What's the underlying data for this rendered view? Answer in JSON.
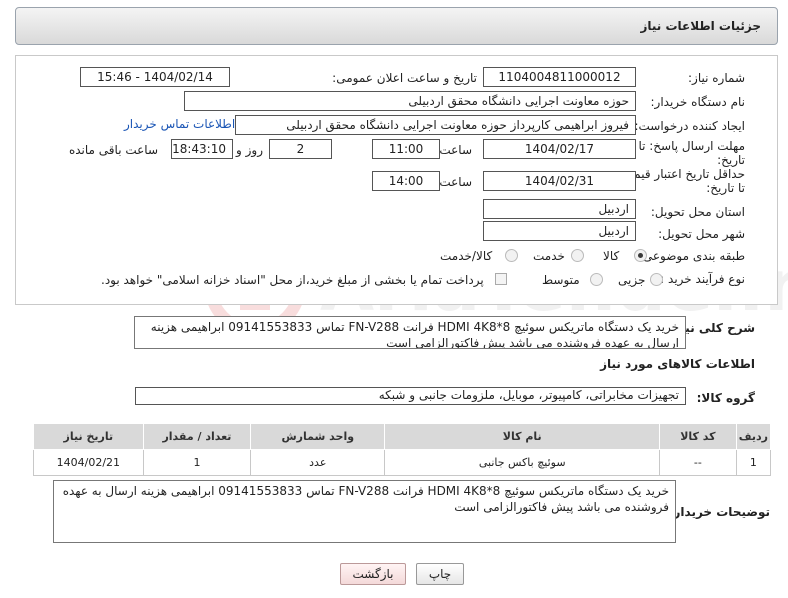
{
  "header": {
    "title": "جزئیات اطلاعات نیاز"
  },
  "form": {
    "need_number_label": "شماره نیاز:",
    "need_number": "1104004811000012",
    "announce_label": "تاریخ و ساعت اعلان عمومی:",
    "announce_value": "1404/02/14 - 15:46",
    "buyer_org_label": "نام دستگاه خریدار:",
    "buyer_org": "حوزه معاونت اجرایی دانشگاه محقق اردبیلی",
    "creator_label": "ایجاد کننده درخواست:",
    "creator": "فیروز ابراهیمی کارپرداز حوزه معاونت اجرایی دانشگاه محقق اردبیلی",
    "contact_link": "اطلاعات تماس خریدار",
    "deadline_label_1": "مهلت ارسال پاسخ: تا",
    "deadline_label_2": "تاریخ:",
    "deadline_date": "1404/02/17",
    "time_label": "ساعت",
    "deadline_time": "11:00",
    "days_value": "2",
    "days_label": "روز و",
    "remaining_time": "18:43:10",
    "remaining_label": "ساعت باقی مانده",
    "price_valid_label_1": "حداقل تاریخ اعتبار قیمت:",
    "price_valid_label_2": "تا تاریخ:",
    "price_valid_date": "1404/02/31",
    "price_valid_time": "14:00",
    "province_label": "استان محل تحویل:",
    "province": "اردبیل",
    "city_label": "شهر محل تحویل:",
    "city": "اردبیل",
    "category_label": "طبقه بندی موضوعی:",
    "category_options": [
      "کالا",
      "خدمت",
      "کالا/خدمت"
    ],
    "process_label": "نوع فرآیند خرید :",
    "process_options": [
      "جزیی",
      "متوسط"
    ],
    "payment_note": "پرداخت تمام یا بخشی از مبلغ خرید،از محل \"اسناد خزانه اسلامی\" خواهد بود."
  },
  "description": {
    "label": "شرح کلی نیاز:",
    "text": "خرید یک دستگاه ماتریکس سوئیچ HDMI  4K8*8 فرانت   FN-V288 تماس 09141553833 ابراهیمی هزینه ارسال به عهده فروشنده می باشد  پیش فاکتورالزامی است"
  },
  "goods": {
    "section_title": "اطلاعات کالاهای مورد نیاز",
    "group_label": "گروه کالا:",
    "group_value": "تجهیزات مخابراتی، کامپیوتر، موبایل، ملزومات جانبی و شبکه",
    "columns": [
      "ردیف",
      "کد کالا",
      "نام کالا",
      "واحد شمارش",
      "تعداد / مقدار",
      "تاریخ نیاز"
    ],
    "rows": [
      [
        "1",
        "--",
        "سوئیچ باکس جانبی",
        "عدد",
        "1",
        "1404/02/21"
      ]
    ]
  },
  "buyer_notes": {
    "label": "توضیحات خریدار:",
    "text": "خرید یک دستگاه ماتریکس سوئیچ HDMI  4K8*8 فرانت   FN-V288 تماس 09141553833 ابراهیمی هزینه ارسال به عهده فروشنده می باشد  پیش فاکتورالزامی است"
  },
  "buttons": {
    "print": "چاپ",
    "back": "بازگشت"
  }
}
